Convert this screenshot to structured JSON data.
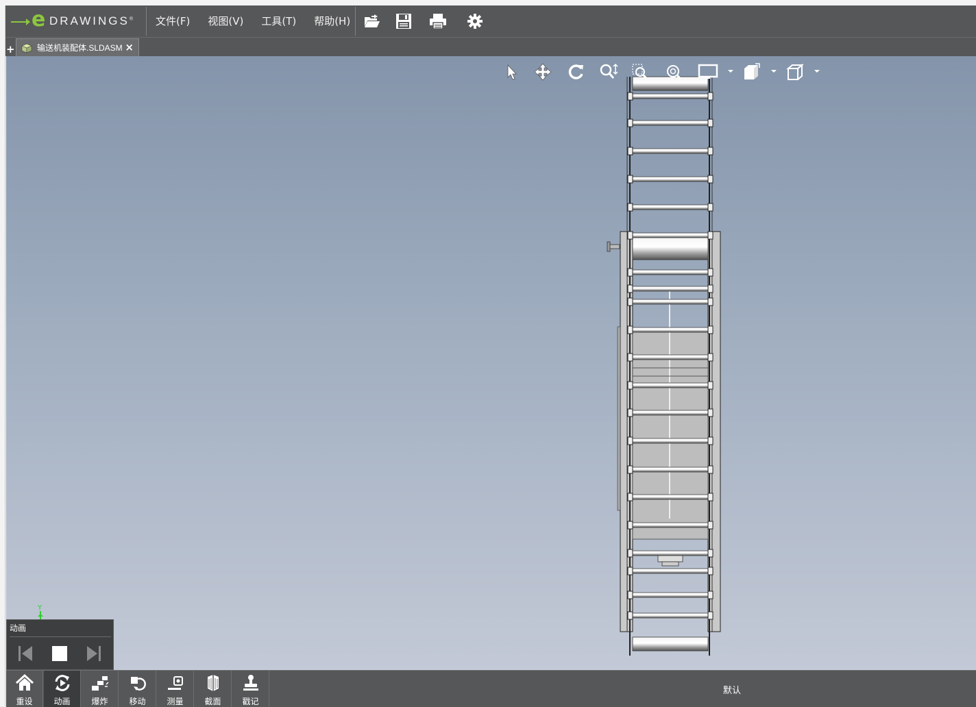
{
  "app": {
    "logo_text": "DRAWINGS",
    "logo_letter": "e"
  },
  "menu": [
    {
      "label": "文件(F)"
    },
    {
      "label": "视图(V)"
    },
    {
      "label": "工具(T)"
    },
    {
      "label": "帮助(H)"
    }
  ],
  "toolbar": {
    "icons": [
      "open-icon",
      "save-icon",
      "print-icon",
      "settings-gear-icon"
    ]
  },
  "tab": {
    "add_label": "+",
    "document_name": "输送机装配体.SLDASM",
    "close_label": "×"
  },
  "view_toolbar": {
    "icons": [
      "select-arrow-icon",
      "pan-icon",
      "rotate-icon",
      "zoom-icon",
      "zoom-to-area-icon",
      "zoom-to-fit-icon",
      "display-style-icon",
      "view-orientation-icon",
      "standard-views-icon"
    ]
  },
  "triad": {
    "axis_label": "Y"
  },
  "animation_panel": {
    "title": "动画",
    "controls": [
      "previous-icon",
      "stop-icon",
      "next-icon"
    ]
  },
  "bottom_toolbar": {
    "items": [
      {
        "label": "重设",
        "icon": "home-icon",
        "active": false
      },
      {
        "label": "动画",
        "icon": "animate-icon",
        "active": true
      },
      {
        "label": "爆炸",
        "icon": "explode-icon",
        "active": false
      },
      {
        "label": "移动",
        "icon": "move-icon",
        "active": false
      },
      {
        "label": "测量",
        "icon": "measure-icon",
        "active": false
      },
      {
        "label": "截面",
        "icon": "section-icon",
        "active": false
      },
      {
        "label": "戳记",
        "icon": "stamp-icon",
        "active": false
      }
    ],
    "configuration": "默认"
  },
  "colors": {
    "menubar": "#565758",
    "accent": "#8cc63f",
    "viewport_top": "#8494aa",
    "viewport_bottom": "#c3c9d6"
  }
}
